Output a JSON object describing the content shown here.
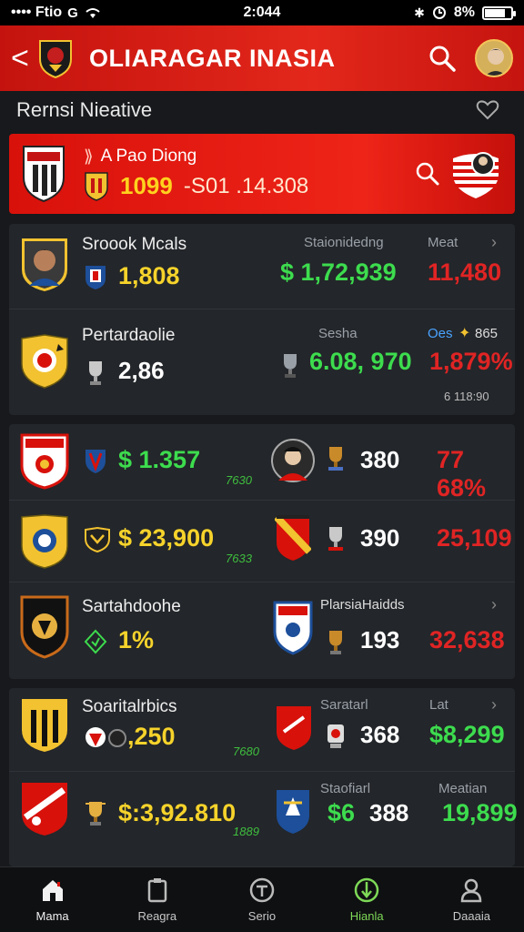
{
  "status": {
    "carrier": "•••• Ftio",
    "time": "2:044",
    "battery_text": "8%",
    "battery_level": 0.8
  },
  "header": {
    "back_glyph": "<",
    "title": "OLIARAGAR INASIA",
    "accent": "#e3271b"
  },
  "subheader": {
    "title": "Rernsi Nieative"
  },
  "featured": {
    "name": "A Pao Diong",
    "value": "1099",
    "range": "-S01 .14.308"
  },
  "card1": {
    "rows": [
      {
        "name": "Sroook Mcals",
        "value": "1,808",
        "mid_label": "Staionidedng",
        "mid_value": "$ 1,72,939",
        "right_label": "Meat",
        "right_value": "11,480"
      },
      {
        "name": "Pertardaolie",
        "value": "2,86",
        "mid_label": "Sesha",
        "mid_value": "6.08, 970",
        "right_label": "Oes",
        "right_label2": "865",
        "right_value": "1,879%",
        "right_sub": "6 118:90"
      }
    ]
  },
  "card2": {
    "rows": [
      {
        "value": "$ 1.357",
        "tiny": "7630",
        "mid_value": "380",
        "right_value": "77 68%"
      },
      {
        "value": "$ 23,900",
        "tiny": "7633",
        "mid_value": "390",
        "right_value": "25,109"
      },
      {
        "name": "Sartahdoohe",
        "value": "1%",
        "mid_label": "PlarsiaHaidds",
        "mid_value": "193",
        "right_value": "32,638"
      }
    ]
  },
  "card3": {
    "rows": [
      {
        "name": "Soaritalrbics",
        "value": ",250",
        "tiny": "7680",
        "mid_label": "Saratarl",
        "mid_value": "368",
        "right_label": "Lat",
        "right_value": "$8,299"
      },
      {
        "value": "$:3,92.810",
        "tiny": "1889",
        "mid_label": "Staofiarl",
        "mid_value_g": "$6",
        "mid_value": "388",
        "right_label": "Meatian",
        "right_value": "19,899"
      }
    ]
  },
  "nav": [
    {
      "label": "Mama",
      "icon": "home-icon"
    },
    {
      "label": "Reagra",
      "icon": "clipboard-icon"
    },
    {
      "label": "Serio",
      "icon": "shield-icon"
    },
    {
      "label": "Hianla",
      "icon": "compass-icon"
    },
    {
      "label": "Daaaia",
      "icon": "profile-icon"
    }
  ],
  "colors": {
    "value_yellow": "#f6d32b",
    "value_green": "#3ddc4e",
    "value_red": "#e02424",
    "background": "#17191c"
  }
}
